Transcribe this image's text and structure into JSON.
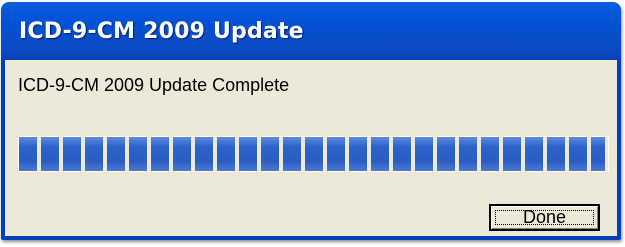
{
  "window": {
    "title": "ICD-9-CM 2009 Update"
  },
  "dialog": {
    "message": "ICD-9-CM 2009 Update Complete",
    "progress": {
      "value_percent": 100
    },
    "done_button_label": "Done"
  },
  "colors": {
    "titlebar": "#0452d5",
    "client_background": "#ece9d8",
    "progress_segment": "#2b62c9"
  }
}
